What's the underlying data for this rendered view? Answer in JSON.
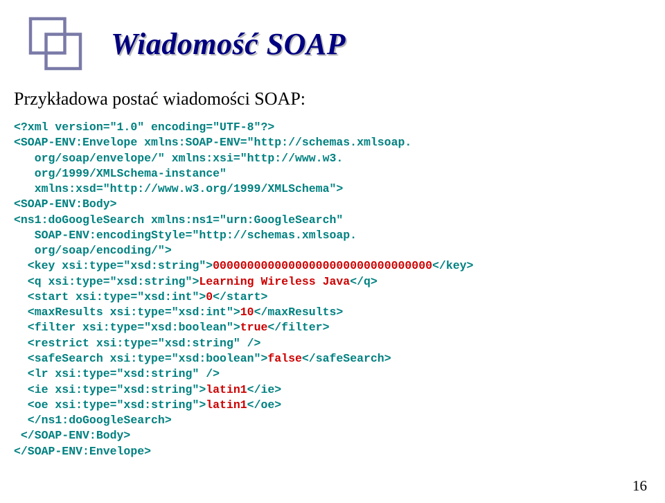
{
  "title": "Wiadomość SOAP",
  "subtitle": "Przykładowa postać wiadomości SOAP:",
  "page_number": "16",
  "code": {
    "l1": "<?xml version=\"1.0\" encoding=\"UTF-8\"?>",
    "l2": "<SOAP-ENV:Envelope xmlns:SOAP-ENV=\"http://schemas.xmlsoap.",
    "l3": "   org/soap/envelope/\" xmlns:xsi=\"http://www.w3.",
    "l4": "   org/1999/XMLSchema-instance\"",
    "l5": "   xmlns:xsd=\"http://www.w3.org/1999/XMLSchema\">",
    "l6": "<SOAP-ENV:Body>",
    "l7": "<ns1:doGoogleSearch xmlns:ns1=\"urn:GoogleSearch\"",
    "l8": "   SOAP-ENV:encodingStyle=\"http://schemas.xmlsoap.",
    "l9": "   org/soap/encoding/\">",
    "l10a": "  <key xsi:type=\"xsd:string\">",
    "l10b": "00000000000000000000000000000000",
    "l10c": "</key>",
    "l11a": "  <q xsi:type=\"xsd:string\">",
    "l11b": "Learning Wireless Java",
    "l11c": "</q>",
    "l12a": "  <start xsi:type=\"xsd:int\">",
    "l12b": "0",
    "l12c": "</start>",
    "l13a": "  <maxResults xsi:type=\"xsd:int\">",
    "l13b": "10",
    "l13c": "</maxResults>",
    "l14a": "  <filter xsi:type=\"xsd:boolean\">",
    "l14b": "true",
    "l14c": "</filter>",
    "l15": "  <restrict xsi:type=\"xsd:string\" />",
    "l16a": "  <safeSearch xsi:type=\"xsd:boolean\">",
    "l16b": "false",
    "l16c": "</safeSearch>",
    "l17": "  <lr xsi:type=\"xsd:string\" />",
    "l18a": "  <ie xsi:type=\"xsd:string\">",
    "l18b": "latin1",
    "l18c": "</ie>",
    "l19a": "  <oe xsi:type=\"xsd:string\">",
    "l19b": "latin1",
    "l19c": "</oe>",
    "l20": "  </ns1:doGoogleSearch>",
    "l21": " </SOAP-ENV:Body>",
    "l22": "</SOAP-ENV:Envelope>"
  }
}
